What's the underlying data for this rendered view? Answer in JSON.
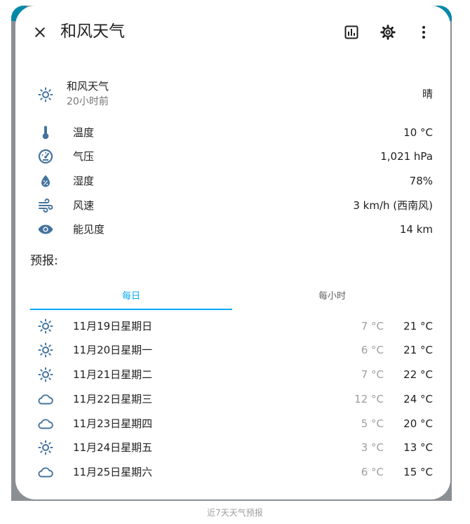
{
  "colors": {
    "accent": "#03a9f4",
    "icon": "#44739e",
    "text_secondary": "#757575",
    "low_temp": "#9e9e9e"
  },
  "header": {
    "title": "和风天气",
    "close_icon": "close-icon",
    "history_icon": "chart-icon",
    "settings_icon": "gear-icon",
    "more_icon": "more-vertical-icon"
  },
  "state": {
    "name": "和风天气",
    "last_changed": "20小时前",
    "condition": "晴",
    "icon": "sunny-icon"
  },
  "attributes": [
    {
      "icon": "thermometer-icon",
      "label": "温度",
      "value": "10 °C"
    },
    {
      "icon": "gauge-icon",
      "label": "气压",
      "value": "1,021 hPa"
    },
    {
      "icon": "water-percent-icon",
      "label": "湿度",
      "value": "78%"
    },
    {
      "icon": "wind-icon",
      "label": "风速",
      "value": "3 km/h (西南风)"
    },
    {
      "icon": "eye-icon",
      "label": "能见度",
      "value": "14 km"
    }
  ],
  "forecast": {
    "heading": "预报:",
    "tabs": [
      {
        "label": "每日",
        "selected": true
      },
      {
        "label": "每小时",
        "selected": false
      }
    ],
    "days": [
      {
        "icon": "sunny-icon",
        "date": "11月19日星期日",
        "low": "7 °C",
        "high": "21 °C"
      },
      {
        "icon": "sunny-icon",
        "date": "11月20日星期一",
        "low": "6 °C",
        "high": "21 °C"
      },
      {
        "icon": "sunny-icon",
        "date": "11月21日星期二",
        "low": "7 °C",
        "high": "22 °C"
      },
      {
        "icon": "cloudy-icon",
        "date": "11月22日星期三",
        "low": "12 °C",
        "high": "24 °C"
      },
      {
        "icon": "cloudy-icon",
        "date": "11月23日星期四",
        "low": "5 °C",
        "high": "20 °C"
      },
      {
        "icon": "sunny-icon",
        "date": "11月24日星期五",
        "low": "3 °C",
        "high": "13 °C"
      },
      {
        "icon": "cloudy-icon",
        "date": "11月25日星期六",
        "low": "6 °C",
        "high": "15 °C"
      }
    ]
  },
  "caption": "近7天天气预报"
}
